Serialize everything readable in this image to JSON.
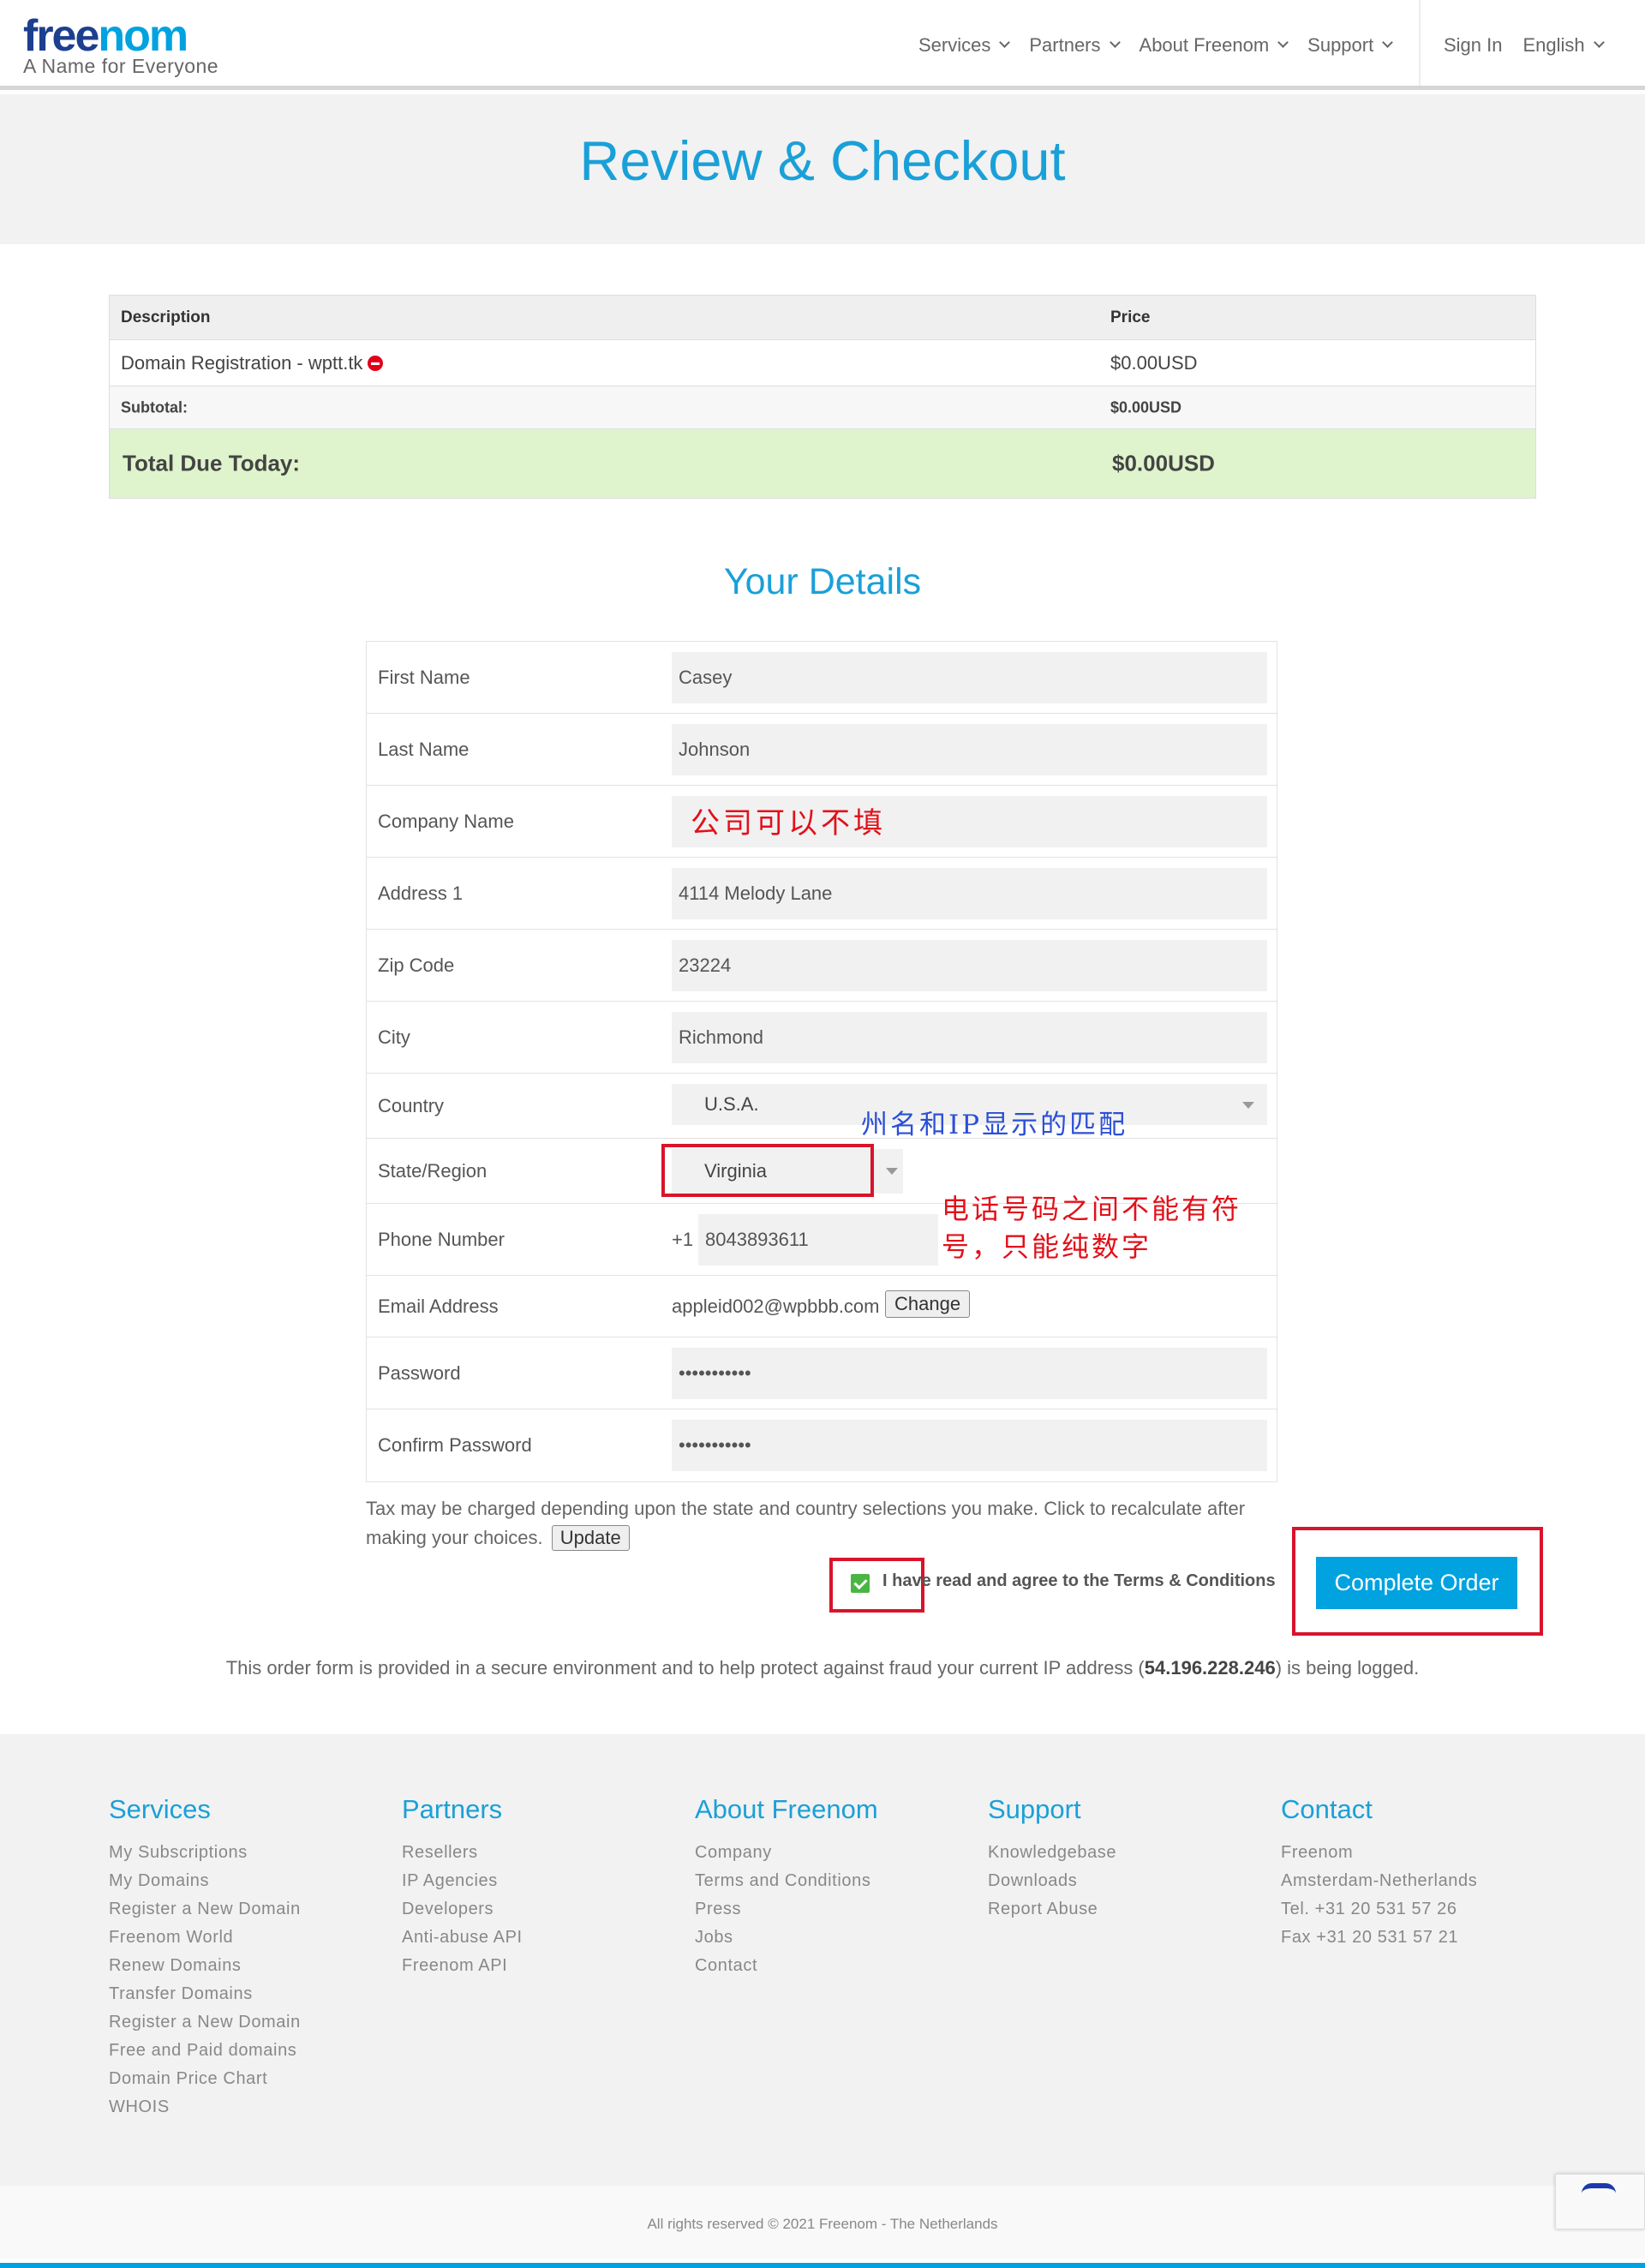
{
  "header": {
    "logo_free": "free",
    "logo_nom": "nom",
    "tagline": "A Name for Everyone",
    "nav": [
      "Services",
      "Partners",
      "About Freenom",
      "Support"
    ],
    "sign_in": "Sign In",
    "language": "English"
  },
  "page_title": "Review & Checkout",
  "order": {
    "col_description": "Description",
    "col_price": "Price",
    "item_description": "Domain Registration - wptt.tk",
    "item_price": "$0.00USD",
    "subtotal_label": "Subtotal:",
    "subtotal_value": "$0.00USD",
    "total_label": "Total Due Today:",
    "total_value": "$0.00USD"
  },
  "details_title": "Your Details",
  "details": {
    "first_name_label": "First Name",
    "first_name": "Casey",
    "last_name_label": "Last Name",
    "last_name": "Johnson",
    "company_label": "Company Name",
    "company_annotation": "公司可以不填",
    "address_label": "Address 1",
    "address": "4114 Melody Lane",
    "zip_label": "Zip Code",
    "zip": "23224",
    "city_label": "City",
    "city": "Richmond",
    "country_label": "Country",
    "country": "U.S.A.",
    "state_annotation": "州名和IP显示的匹配",
    "state_label": "State/Region",
    "state": "Virginia",
    "phone_annotation_1": "电话号码之间不能有符",
    "phone_annotation_2": "号，只能纯数字",
    "phone_label": "Phone Number",
    "phone_prefix": "+1",
    "phone": "8043893611",
    "email_label": "Email Address",
    "email": "appleid002@wpbbb.com",
    "change_button": "Change",
    "password_label": "Password",
    "password": "•••••••••••",
    "confirm_label": "Confirm Password",
    "confirm_password": "•••••••••••"
  },
  "tax": {
    "note": "Tax may be charged depending upon the state and country selections you make. Click to recalculate after making your choices.",
    "update_button": "Update"
  },
  "agree_text": "I have read and agree to the Terms & Conditions",
  "complete_button": "Complete Order",
  "secure": {
    "before": "This order form is provided in a secure environment and to help protect against fraud your current IP address (",
    "ip": "54.196.228.246",
    "after": ") is being logged."
  },
  "footer": {
    "services": {
      "title": "Services",
      "items": [
        "My Subscriptions",
        "My Domains",
        "Register a New Domain",
        "Freenom World",
        "Renew Domains",
        "Transfer Domains",
        "Register a New Domain",
        "Free and Paid domains",
        "Domain Price Chart",
        "WHOIS"
      ]
    },
    "partners": {
      "title": "Partners",
      "items": [
        "Resellers",
        "IP Agencies",
        "Developers",
        "Anti-abuse API",
        "Freenom API"
      ]
    },
    "about": {
      "title": "About Freenom",
      "items": [
        "Company",
        "Terms and Conditions",
        "Press",
        "Jobs",
        "Contact"
      ]
    },
    "support": {
      "title": "Support",
      "items": [
        "Knowledgebase",
        "Downloads",
        "Report Abuse"
      ]
    },
    "contact": {
      "title": "Contact",
      "items": [
        "Freenom",
        "Amsterdam-Netherlands",
        "Tel. +31 20 531 57 26",
        "Fax +31 20 531 57 21"
      ]
    }
  },
  "copyright": "All rights reserved © 2021 Freenom - The Netherlands",
  "colors": {
    "accent": "#00a2e0",
    "title": "#1aa0d8",
    "logo_dark": "#1d3f8f",
    "total_bg": "#dff4cc",
    "annotation_red": "#e2101a",
    "annotation_blue": "#2b4fd6"
  }
}
